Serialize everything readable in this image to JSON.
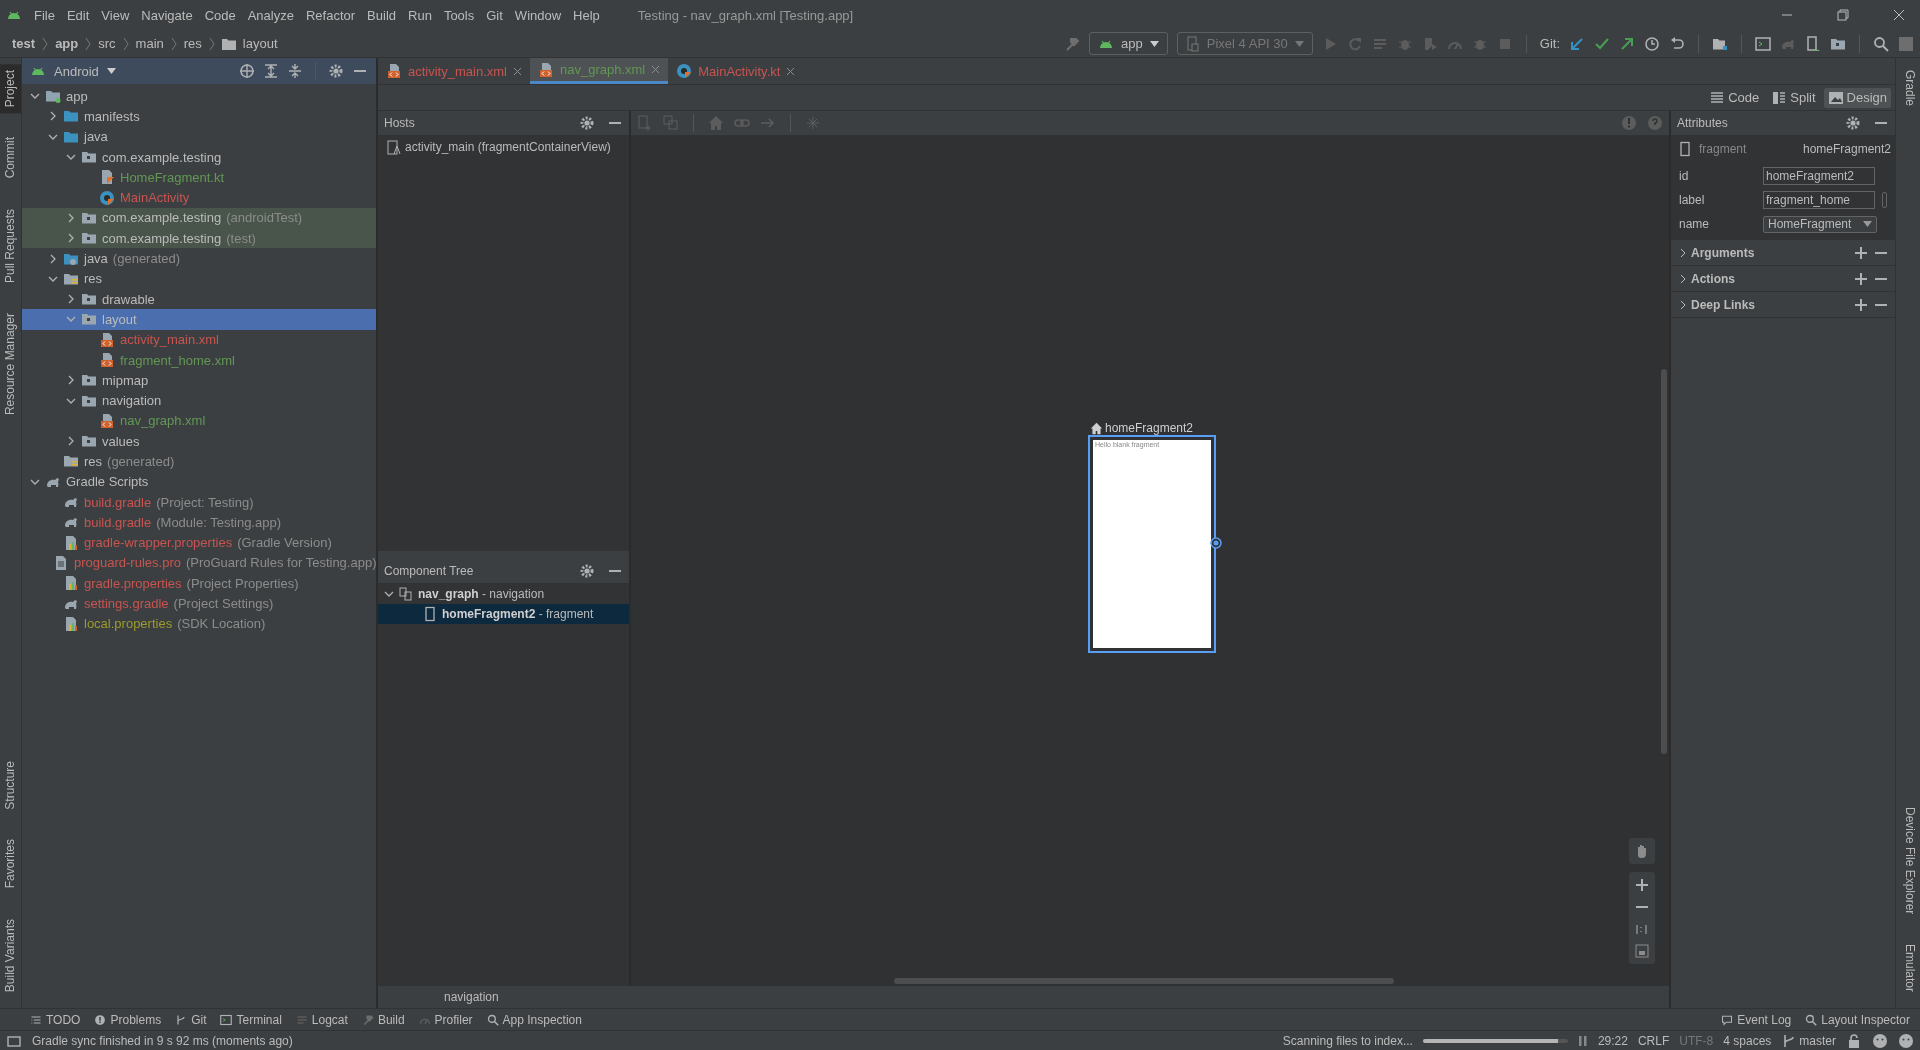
{
  "window": {
    "title": "Testing - nav_graph.xml [Testing.app]"
  },
  "menu": [
    "File",
    "Edit",
    "View",
    "Navigate",
    "Code",
    "Analyze",
    "Refactor",
    "Build",
    "Run",
    "Tools",
    "Git",
    "Window",
    "Help"
  ],
  "breadcrumb": [
    {
      "label": "test",
      "bold": true
    },
    {
      "label": "app",
      "bold": true
    },
    {
      "label": "src",
      "bold": false
    },
    {
      "label": "main",
      "bold": false
    },
    {
      "label": "res",
      "bold": false
    },
    {
      "label": "layout",
      "bold": false
    }
  ],
  "toolbar": {
    "run_config": "app",
    "device": "Pixel 4 API 30",
    "git_label": "Git:"
  },
  "left_tool_tabs": {
    "top": [
      {
        "label": "Project",
        "selected": true
      },
      {
        "label": "Commit",
        "selected": false
      },
      {
        "label": "Pull Requests",
        "selected": false
      },
      {
        "label": "Resource Manager",
        "selected": false
      }
    ],
    "bottom": [
      {
        "label": "Structure",
        "selected": false
      },
      {
        "label": "Favorites",
        "selected": false
      },
      {
        "label": "Build Variants",
        "selected": false
      }
    ]
  },
  "right_tool_tabs": {
    "top": [
      {
        "label": "Gradle",
        "selected": false
      }
    ],
    "bottom": [
      {
        "label": "Device File Explorer",
        "selected": false
      },
      {
        "label": "Emulator",
        "selected": false
      }
    ]
  },
  "project_panel": {
    "view": "Android",
    "tree": [
      {
        "name": "app",
        "kind": "module",
        "expanded": true,
        "selected": false,
        "children": [
          {
            "name": "manifests",
            "kind": "source_folder",
            "expanded": false,
            "selected": false
          },
          {
            "name": "java",
            "kind": "source_folder",
            "expanded": true,
            "selected": false,
            "children": [
              {
                "name": "com.example.testing",
                "kind": "package",
                "expanded": true,
                "selected": false,
                "children": [
                  {
                    "name": "HomeFragment.kt",
                    "kind": "kotlin",
                    "color": "#629755",
                    "selected": false
                  },
                  {
                    "name": "MainActivity",
                    "kind": "activity",
                    "color": "#c75450",
                    "selected": false
                  }
                ]
              },
              {
                "name": "com.example.testing",
                "note": "(androidTest)",
                "kind": "package",
                "test_scope": true,
                "expanded": false,
                "selected": false
              },
              {
                "name": "com.example.testing",
                "note": "(test)",
                "kind": "package",
                "test_scope": true,
                "expanded": false,
                "selected": false
              }
            ]
          },
          {
            "name": "java",
            "note": "(generated)",
            "kind": "generated",
            "expanded": false,
            "selected": false
          },
          {
            "name": "res",
            "kind": "resources",
            "expanded": true,
            "selected": false,
            "children": [
              {
                "name": "drawable",
                "kind": "package",
                "expanded": false,
                "selected": false
              },
              {
                "name": "layout",
                "kind": "package",
                "expanded": true,
                "selected": true,
                "children": [
                  {
                    "name": "activity_main.xml",
                    "kind": "xml",
                    "color": "#c75450",
                    "selected": false
                  },
                  {
                    "name": "fragment_home.xml",
                    "kind": "xml",
                    "color": "#629755",
                    "selected": false
                  }
                ]
              },
              {
                "name": "mipmap",
                "kind": "package",
                "expanded": false,
                "selected": false
              },
              {
                "name": "navigation",
                "kind": "package",
                "expanded": true,
                "selected": false,
                "children": [
                  {
                    "name": "nav_graph.xml",
                    "kind": "xml",
                    "color": "#629755",
                    "selected": false
                  }
                ]
              },
              {
                "name": "values",
                "kind": "package",
                "expanded": false,
                "selected": false
              }
            ]
          },
          {
            "name": "res",
            "note": "(generated)",
            "kind": "resources",
            "selected": false
          }
        ]
      },
      {
        "name": "Gradle Scripts",
        "kind": "gradle",
        "expanded": true,
        "selected": false,
        "children": [
          {
            "name": "build.gradle",
            "note": "(Project: Testing)",
            "kind": "gradle",
            "color": "#c75450",
            "selected": false
          },
          {
            "name": "build.gradle",
            "note": "(Module: Testing.app)",
            "kind": "gradle",
            "color": "#c75450",
            "selected": false
          },
          {
            "name": "gradle-wrapper.properties",
            "note": "(Gradle Version)",
            "kind": "properties",
            "color": "#c75450",
            "selected": false
          },
          {
            "name": "proguard-rules.pro",
            "note": "(ProGuard Rules for Testing.app)",
            "kind": "text",
            "color": "#c75450",
            "selected": false
          },
          {
            "name": "gradle.properties",
            "note": "(Project Properties)",
            "kind": "properties",
            "color": "#c75450",
            "selected": false
          },
          {
            "name": "settings.gradle",
            "note": "(Project Settings)",
            "kind": "gradle",
            "color": "#c75450",
            "selected": false
          },
          {
            "name": "local.properties",
            "note": "(SDK Location)",
            "kind": "properties",
            "color": "#9b9b2c",
            "selected": false
          }
        ]
      }
    ]
  },
  "editor_tabs": [
    {
      "label": "activity_main.xml",
      "kind": "xml",
      "color": "#c75450",
      "selected": false
    },
    {
      "label": "nav_graph.xml",
      "kind": "xml",
      "color": "#629755",
      "selected": true
    },
    {
      "label": "MainActivity.kt",
      "kind": "activity",
      "color": "#c75450",
      "selected": false
    }
  ],
  "view_modes": [
    {
      "label": "Code",
      "selected": false
    },
    {
      "label": "Split",
      "selected": false
    },
    {
      "label": "Design",
      "selected": true
    }
  ],
  "hosts": {
    "title": "Hosts",
    "items": [
      "activity_main (fragmentContainerView)"
    ]
  },
  "component_tree": {
    "title": "Component Tree",
    "items": [
      {
        "name": "nav_graph",
        "type": "- navigation",
        "expanded": true,
        "selected": false,
        "children": [
          {
            "name": "homeFragment2",
            "type": "- fragment",
            "selected": true
          }
        ]
      }
    ]
  },
  "canvas": {
    "destination": {
      "label": "homeFragment2",
      "start": true,
      "selected": true,
      "preview_text": "Hello blank fragment"
    },
    "footer": "navigation"
  },
  "attributes": {
    "title": "Attributes",
    "element_type": "fragment",
    "element_id": "homeFragment2",
    "fields": [
      {
        "label": "id",
        "value": "homeFragment2",
        "kind": "text"
      },
      {
        "label": "label",
        "value": "fragment_home",
        "kind": "text_picker"
      },
      {
        "label": "name",
        "value": "HomeFragment",
        "kind": "dropdown"
      }
    ],
    "sections": [
      {
        "label": "Arguments",
        "expanded": false
      },
      {
        "label": "Actions",
        "expanded": false
      },
      {
        "label": "Deep Links",
        "expanded": false
      }
    ]
  },
  "bottom_tabs": {
    "left": [
      "TODO",
      "Problems",
      "Git",
      "Terminal",
      "Logcat",
      "Build",
      "Profiler",
      "App Inspection"
    ],
    "right": [
      "Event Log",
      "Layout Inspector"
    ]
  },
  "status_bar": {
    "message": "Gradle sync finished in 9 s 92 ms (moments ago)",
    "task": "Scanning files to index...",
    "level": 0.93,
    "position": "29:22",
    "line_separator": "CRLF",
    "encoding": "UTF-8",
    "encoding_disabled": true,
    "indent": "4 spaces",
    "branch": "master"
  }
}
